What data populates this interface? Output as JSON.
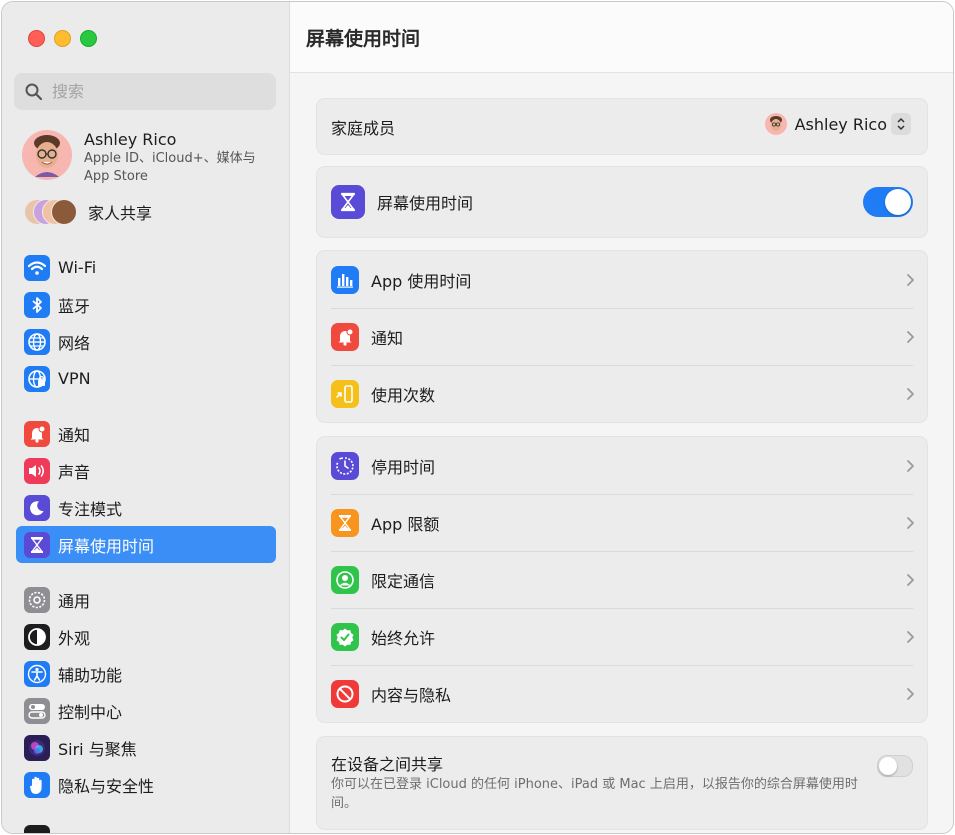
{
  "sidebar": {
    "search_placeholder": "搜索",
    "account": {
      "name": "Ashley Rico",
      "subtitle": "Apple ID、iCloud+、媒体与 App Store"
    },
    "family_label": "家人共享",
    "groups": [
      [
        {
          "label": "Wi-Fi",
          "icon": "wifi-icon",
          "color": "#1f7cf5"
        },
        {
          "label": "蓝牙",
          "icon": "bluetooth-icon",
          "color": "#1f7cf5"
        },
        {
          "label": "网络",
          "icon": "globe-icon",
          "color": "#1f7cf5"
        },
        {
          "label": "VPN",
          "icon": "vpn-globe-icon",
          "color": "#1f7cf5"
        }
      ],
      [
        {
          "label": "通知",
          "icon": "bell-badge-icon",
          "color": "#f04a3f"
        },
        {
          "label": "声音",
          "icon": "speaker-icon",
          "color": "#f03a5a"
        },
        {
          "label": "专注模式",
          "icon": "moon-icon",
          "color": "#5a4bd6"
        },
        {
          "label": "屏幕使用时间",
          "icon": "hourglass-icon",
          "color": "#5a4bd6",
          "active": true
        }
      ],
      [
        {
          "label": "通用",
          "icon": "gear-icon",
          "color": "#8e8e93"
        },
        {
          "label": "外观",
          "icon": "appearance-icon",
          "color": "#1d1d1f"
        },
        {
          "label": "辅助功能",
          "icon": "accessibility-icon",
          "color": "#1f7cf5"
        },
        {
          "label": "控制中心",
          "icon": "switches-icon",
          "color": "#8e8e93"
        },
        {
          "label": "Siri 与聚焦",
          "icon": "siri-icon",
          "color": "#2b1d55"
        },
        {
          "label": "隐私与安全性",
          "icon": "hand-icon",
          "color": "#1f7cf5"
        }
      ]
    ]
  },
  "main": {
    "title": "屏幕使用时间",
    "family_member": {
      "label": "家庭成员",
      "value": "Ashley Rico"
    },
    "screen_time": {
      "label": "屏幕使用时间",
      "enabled": true
    },
    "group1": [
      {
        "label": "App 使用时间",
        "icon": "bar-chart-icon",
        "color": "#1f7cf5"
      },
      {
        "label": "通知",
        "icon": "bell-badge-icon",
        "color": "#f04a3f"
      },
      {
        "label": "使用次数",
        "icon": "pickups-icon",
        "color": "#f5c01a"
      }
    ],
    "group2": [
      {
        "label": "停用时间",
        "icon": "downtime-icon",
        "color": "#5a4bd6"
      },
      {
        "label": "App 限额",
        "icon": "hourglass-icon",
        "color": "#f7951f"
      },
      {
        "label": "限定通信",
        "icon": "person-circle-icon",
        "color": "#30c44d"
      },
      {
        "label": "始终允许",
        "icon": "checkmark-seal-icon",
        "color": "#30c44d"
      },
      {
        "label": "内容与隐私",
        "icon": "restricted-icon",
        "color": "#f03a3a"
      }
    ],
    "share": {
      "label": "在设备之间共享",
      "description": "你可以在已登录 iCloud 的任何 iPhone、iPad 或 Mac 上启用，以报告你的综合屏幕使用时间。",
      "enabled": false
    }
  }
}
